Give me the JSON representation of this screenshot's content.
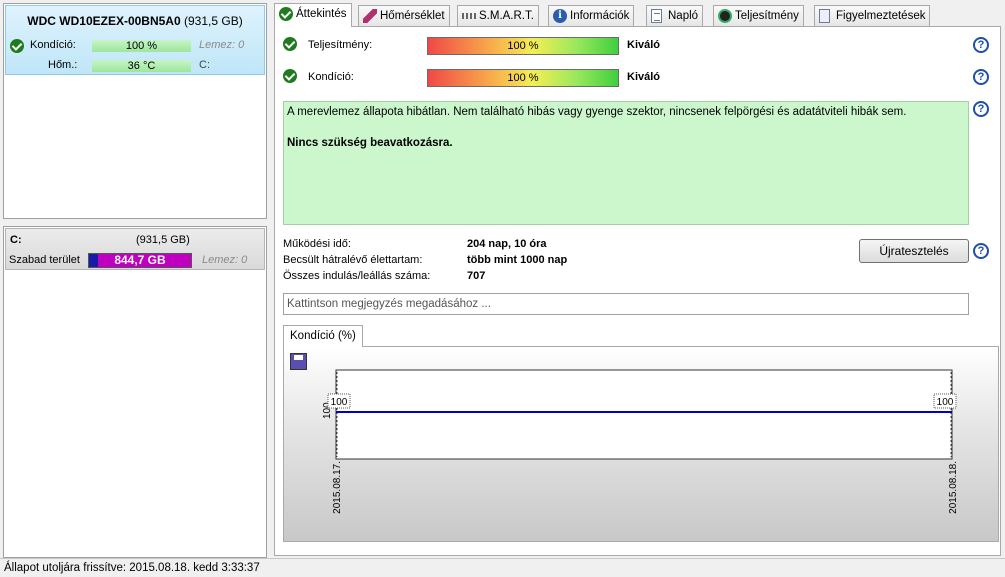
{
  "disk": {
    "model": "WDC WD10EZEX-00BN5A0",
    "size": "(931,5 GB)",
    "condition_label": "Kondíció:",
    "condition_value": "100 %",
    "disk_ref": "Lemez: 0",
    "temp_label": "Hőm.:",
    "temp_value": "36 °C",
    "drive_letter": "C:"
  },
  "volume": {
    "name": "C:",
    "size": "(931,5 GB)",
    "free_label": "Szabad terület",
    "free_value": "844,7 GB",
    "used_fraction": 0.093,
    "disk_ref": "Lemez: 0"
  },
  "tabs": [
    {
      "label": "Áttekintés",
      "icon": "check-icon",
      "active": true
    },
    {
      "label": "Hőmérséklet",
      "icon": "thermometer-icon"
    },
    {
      "label": "S.M.A.R.T.",
      "icon": "smart-icon"
    },
    {
      "label": "Információk",
      "icon": "info-icon"
    },
    {
      "label": "Napló",
      "icon": "log-icon"
    },
    {
      "label": "Teljesítmény",
      "icon": "gauge-icon"
    },
    {
      "label": "Figyelmeztetések",
      "icon": "warning-doc-icon"
    }
  ],
  "overview": {
    "performance_label": "Teljesítmény:",
    "performance_bar": "100 %",
    "performance_rating": "Kiváló",
    "condition_label": "Kondíció:",
    "condition_bar": "100 %",
    "condition_rating": "Kiváló",
    "summary_text": "A merevlemez állapota hibátlan. Nem található hibás vagy gyenge szektor, nincsenek felpörgési és adatátviteli hibák sem.",
    "summary_action": "Nincs szükség beavatkozásra.",
    "uptime_label": "Működési idő:",
    "uptime_value": "204 nap, 10 óra",
    "lifetime_label": "Becsült hátralévő élettartam:",
    "lifetime_value": "több mint 1000 nap",
    "starts_label": "Összes indulás/leállás száma:",
    "starts_value": "707",
    "retest_button": "Újratesztelés",
    "note_placeholder": "Kattintson megjegyzés megadásához ...",
    "help_symbol": "?"
  },
  "chart_tab": {
    "label": "Kondíció  (%)"
  },
  "chart_data": {
    "type": "line",
    "x": [
      "2015.08.17.",
      "2015.08.18."
    ],
    "series": [
      {
        "values": [
          100,
          100
        ]
      }
    ],
    "point_labels": [
      "100",
      "100"
    ],
    "ytick": "100",
    "line_color": "#0000cc"
  },
  "status": {
    "text": "Állapot utoljára frissítve: 2015.08.18. kedd 3:33:37"
  }
}
